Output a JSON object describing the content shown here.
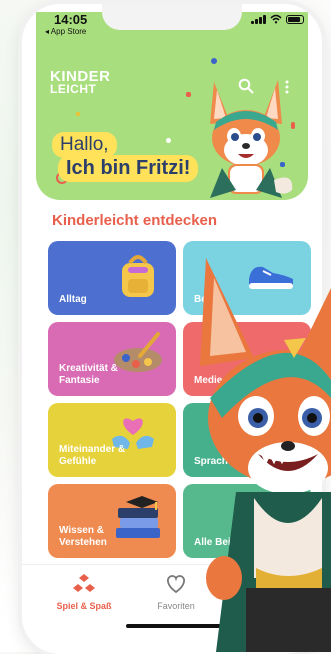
{
  "status_bar": {
    "time": "14:05",
    "back_app": "◂ App Store"
  },
  "hero": {
    "logo_line1": "KINDER",
    "logo_line2": "LEICHT",
    "greeting_line1": "Hallo,",
    "greeting_line2": "Ich bin Fritzi!"
  },
  "section": {
    "title": "Kinderleicht entdecken"
  },
  "tiles": [
    {
      "label": "Alltag",
      "color": "#4c6fd0",
      "icon": "backpack-icon"
    },
    {
      "label": "Bew",
      "color": "#7bd3e2",
      "icon": "sneaker-icon"
    },
    {
      "label": "Kreativität & Fantasie",
      "color": "#d86bb4",
      "icon": "paint-palette-icon"
    },
    {
      "label": "Medie",
      "color": "#ef6b6b",
      "icon": "media-icon"
    },
    {
      "label": "Miteinander & Gefühle",
      "color": "#e6d23a",
      "icon": "heart-hands-icon"
    },
    {
      "label": "Sprache",
      "color": "#46b08c",
      "icon": "speech-icon"
    },
    {
      "label": "Wissen & Verstehen",
      "color": "#ef8a50",
      "icon": "books-icon"
    },
    {
      "label": "Alle Beispi",
      "color": "#56b98e",
      "icon": "all-examples-icon"
    }
  ],
  "bottom_nav": [
    {
      "label": "Spiel & Spaß",
      "icon": "play-blocks-icon",
      "active": true,
      "color": "#e8604c"
    },
    {
      "label": "Favoriten",
      "icon": "heart-outline-icon",
      "active": false,
      "color": "#888888"
    }
  ]
}
